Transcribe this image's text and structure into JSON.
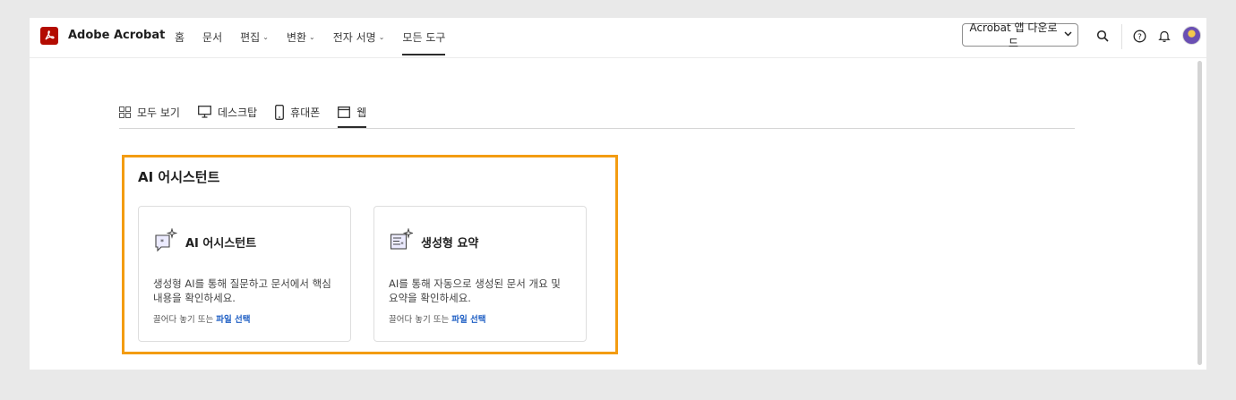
{
  "app": {
    "brand": "Adobe Acrobat"
  },
  "nav": {
    "home": "홈",
    "documents": "문서",
    "edit": "편집",
    "convert": "변환",
    "esign": "전자 서명",
    "all_tools": "모든 도구",
    "active": "모든 도구"
  },
  "toolbar": {
    "download_label": "Acrobat 앱 다운로드",
    "icons": [
      "search-icon",
      "help-icon",
      "bell-icon",
      "avatar"
    ]
  },
  "filters": {
    "tabs": [
      {
        "label": "모두 보기",
        "icon": "grid-icon"
      },
      {
        "label": "데스크탑",
        "icon": "desktop-icon"
      },
      {
        "label": "휴대폰",
        "icon": "phone-icon"
      },
      {
        "label": "웹",
        "icon": "web-icon"
      }
    ],
    "active": "웹"
  },
  "section": {
    "title": "AI 어시스턴트",
    "cards": [
      {
        "title": "AI 어시스턴트",
        "icon": "ai-chat-sparkle-icon",
        "description": "생성형 AI를 통해 질문하고 문서에서 핵심 내용을 확인하세요.",
        "drop_text": "끌어다 놓기 또는",
        "link": "파일 선택"
      },
      {
        "title": "생성형 요약",
        "icon": "summary-sparkle-icon",
        "description": "AI를 통해 자동으로 생성된 문서 개요 및 요약을 확인하세요.",
        "drop_text": "끌어다 놓기 또는",
        "link": "파일 선택"
      }
    ]
  },
  "colors": {
    "brand_red": "#b30b00",
    "highlight_orange": "#f39c12",
    "link_blue": "#1f5fc4"
  }
}
